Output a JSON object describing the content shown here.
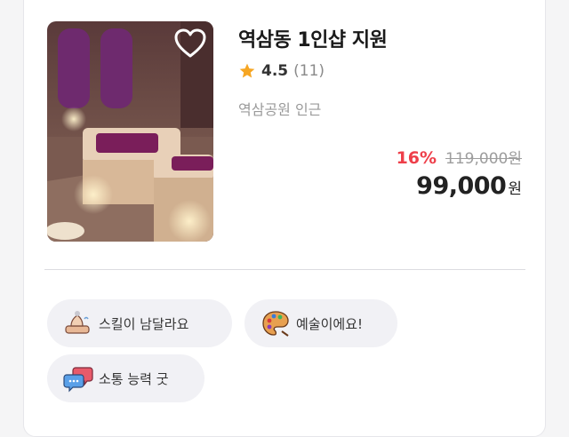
{
  "product": {
    "title": "역삼동 1인샵 지원",
    "rating": "4.5",
    "review_count": "(11)",
    "location": "역삼공원 인근",
    "discount": "16%",
    "original_price": "119,000원",
    "price": "99,000",
    "price_unit": "원",
    "image_icon": "spa-room-photo",
    "wishlist_icon": "heart-outline-icon"
  },
  "tags": [
    {
      "icon": "massage-hands-icon",
      "label": "스킬이 남달라요"
    },
    {
      "icon": "palette-icon",
      "label": "예술이에요!"
    },
    {
      "icon": "speech-bubbles-icon",
      "label": "소통 능력 굿"
    }
  ],
  "colors": {
    "discount": "#ee3f4a",
    "star": "#f6a623",
    "tag_background": "#f1f1f5"
  }
}
